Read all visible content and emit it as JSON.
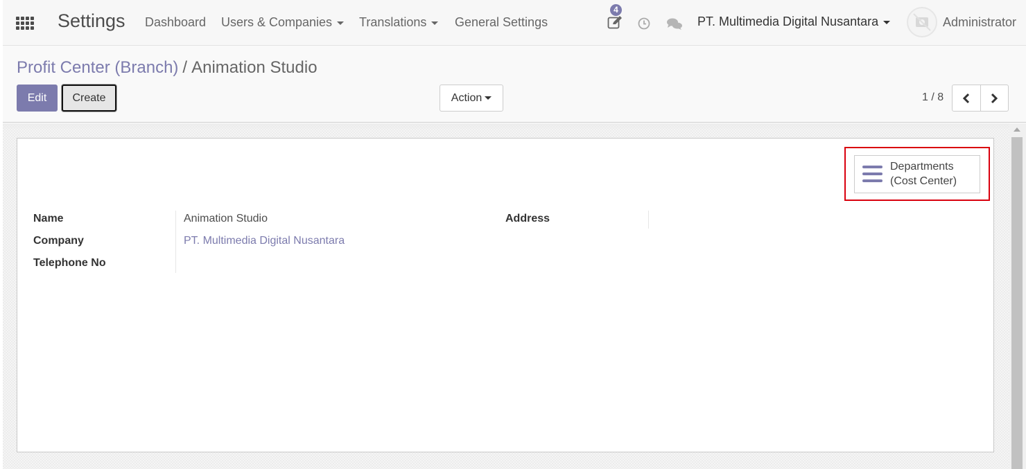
{
  "navbar": {
    "apps_icon": "apps-grid-icon",
    "app_title": "Settings",
    "menu": [
      {
        "label": "Dashboard",
        "dropdown": false
      },
      {
        "label": "Users & Companies",
        "dropdown": true
      },
      {
        "label": "Translations",
        "dropdown": true
      },
      {
        "label": "General Settings",
        "dropdown": false
      }
    ],
    "systray": {
      "activity_badge": "4",
      "icons": [
        "edit-note-icon",
        "clock-icon",
        "chat-icon"
      ]
    },
    "company": "PT. Multimedia Digital Nusantara",
    "user": "Administrator"
  },
  "control_panel": {
    "breadcrumb": {
      "parent": "Profit Center (Branch)",
      "separator": "/",
      "current": "Animation Studio"
    },
    "buttons": {
      "edit": "Edit",
      "create": "Create",
      "action": "Action"
    },
    "pager": {
      "value": "1 / 8"
    }
  },
  "form": {
    "smart_button": {
      "line1": "Departments",
      "line2": "(Cost Center)",
      "icon": "list-bars-icon"
    },
    "fields": {
      "name": {
        "label": "Name",
        "value": "Animation Studio"
      },
      "company": {
        "label": "Company",
        "value": "PT. Multimedia Digital Nusantara"
      },
      "telephone": {
        "label": "Telephone No",
        "value": ""
      },
      "address": {
        "label": "Address",
        "value": ""
      }
    }
  },
  "colors": {
    "brand": "#7c7bad",
    "highlight": "#d9000d"
  }
}
